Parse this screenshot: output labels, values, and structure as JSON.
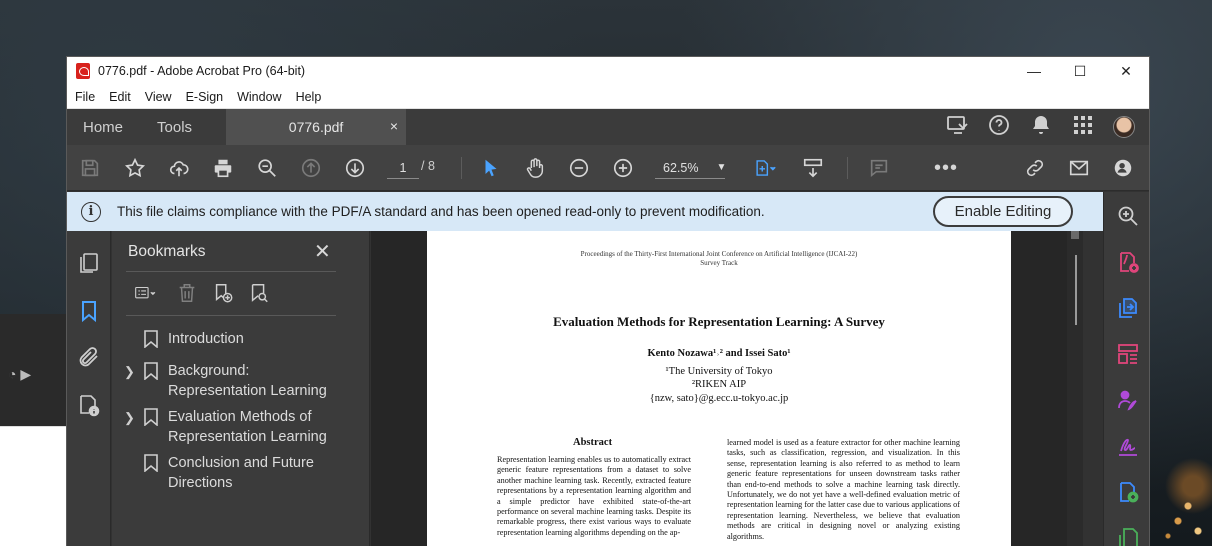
{
  "window": {
    "title": "0776.pdf - Adobe Acrobat Pro (64-bit)",
    "controls": {
      "minimize": "—",
      "maximize": "☐",
      "close": "✕"
    }
  },
  "menu": [
    "File",
    "Edit",
    "View",
    "E-Sign",
    "Window",
    "Help"
  ],
  "tabs": {
    "home": "Home",
    "tools": "Tools",
    "doc": "0776.pdf",
    "doc_close": "×"
  },
  "toolbar": {
    "page_current": "1",
    "page_total": "/ 8",
    "zoom": "62.5%"
  },
  "infobar": {
    "message": "This file claims compliance with the PDF/A standard and has been opened read-only to prevent modification.",
    "button": "Enable Editing",
    "icon": "i"
  },
  "bookmarks": {
    "title": "Bookmarks",
    "close": "✕",
    "items": [
      {
        "label": "Introduction",
        "expandable": false
      },
      {
        "label": "Background: Representation Learning",
        "expandable": true
      },
      {
        "label": "Evaluation Methods of Representation Learning",
        "expandable": true
      },
      {
        "label": "Conclusion and Future Directions",
        "expandable": false
      }
    ]
  },
  "document": {
    "proceedings_line1": "Proceedings of the Thirty-First International Joint Conference on Artificial Intelligence (IJCAI-22)",
    "proceedings_line2": "Survey Track",
    "title": "Evaluation Methods for Representation Learning: A Survey",
    "authors": "Kento Nozawa¹˒² and Issei Sato¹",
    "affil1": "¹The University of Tokyo",
    "affil2": "²RIKEN AIP",
    "email": "{nzw, sato}@g.ecc.u-tokyo.ac.jp",
    "abstract_heading": "Abstract",
    "abstract_text": "Representation learning enables us to automatically extract generic feature representations from a dataset to solve another machine learning task. Recently, extracted feature representations by a representation learning algorithm and a simple predictor have exhibited state-of-the-art performance on several machine learning tasks. Despite its remarkable progress, there exist various ways to evaluate representation learning algorithms depending on the ap-",
    "right_column": "learned model is used as a feature extractor for other machine learning tasks, such as classification, regression, and visualization. In this sense, representation learning is also referred to as method to learn generic feature representations for unseen downstream tasks rather than end-to-end methods to solve a machine learning task directly. Unfortunately, we do not yet have a well-defined evaluation metric of representation learning for the latter case due to various applications of representation learning. Nevertheless, we believe that evaluation methods are critical in designing novel or analyzing existing algorithms."
  },
  "colors": {
    "accent": "#4aa3ff",
    "infobar": "#d7e8f7",
    "rail_magenta": "#e0457b",
    "rail_blue": "#3d8bfd",
    "rail_purple": "#b04ad8",
    "rail_green": "#4ab05a"
  }
}
